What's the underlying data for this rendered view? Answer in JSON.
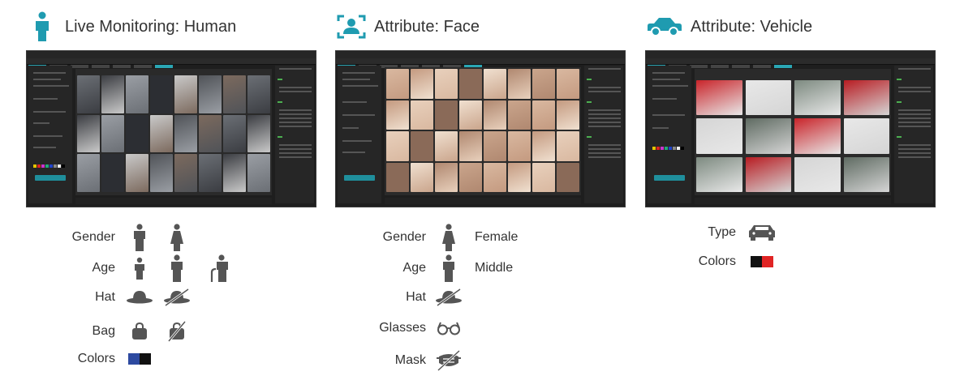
{
  "colors": {
    "accent": "#1f9bb0",
    "icon_gray": "#555555",
    "dark_bg": "#1e1e1e"
  },
  "human": {
    "title": "Live Monitoring: Human",
    "header_icon": "person-icon",
    "attributes": [
      {
        "label": "Gender",
        "icons": [
          "male-icon",
          "female-icon"
        ]
      },
      {
        "label": "Age",
        "icons": [
          "child-icon",
          "adult-icon",
          "elderly-icon"
        ]
      },
      {
        "label": "Hat",
        "icons": [
          "hat-icon",
          "no-hat-icon"
        ]
      },
      {
        "label": "Bag",
        "icons": [
          "bag-icon",
          "no-bag-icon"
        ]
      },
      {
        "label": "Colors",
        "icons": [
          "color-swatch-blue-black"
        ],
        "swatch": [
          "#2d4aa0",
          "#111111"
        ]
      }
    ]
  },
  "face": {
    "title": "Attribute: Face",
    "header_icon": "face-scan-icon",
    "attributes": [
      {
        "label": "Gender",
        "icons": [
          "female-icon"
        ],
        "value": "Female"
      },
      {
        "label": "Age",
        "icons": [
          "adult-icon"
        ],
        "value": "Middle"
      },
      {
        "label": "Hat",
        "icons": [
          "no-hat-icon"
        ]
      },
      {
        "label": "Glasses",
        "icons": [
          "glasses-icon"
        ]
      },
      {
        "label": "Mask",
        "icons": [
          "no-mask-icon"
        ]
      }
    ]
  },
  "vehicle": {
    "title": "Attribute: Vehicle",
    "header_icon": "car-icon",
    "attributes": [
      {
        "label": "Type",
        "icons": [
          "car-icon"
        ]
      },
      {
        "label": "Colors",
        "icons": [
          "color-swatch-black-red"
        ],
        "swatch": [
          "#111111",
          "#e02424"
        ]
      }
    ]
  }
}
